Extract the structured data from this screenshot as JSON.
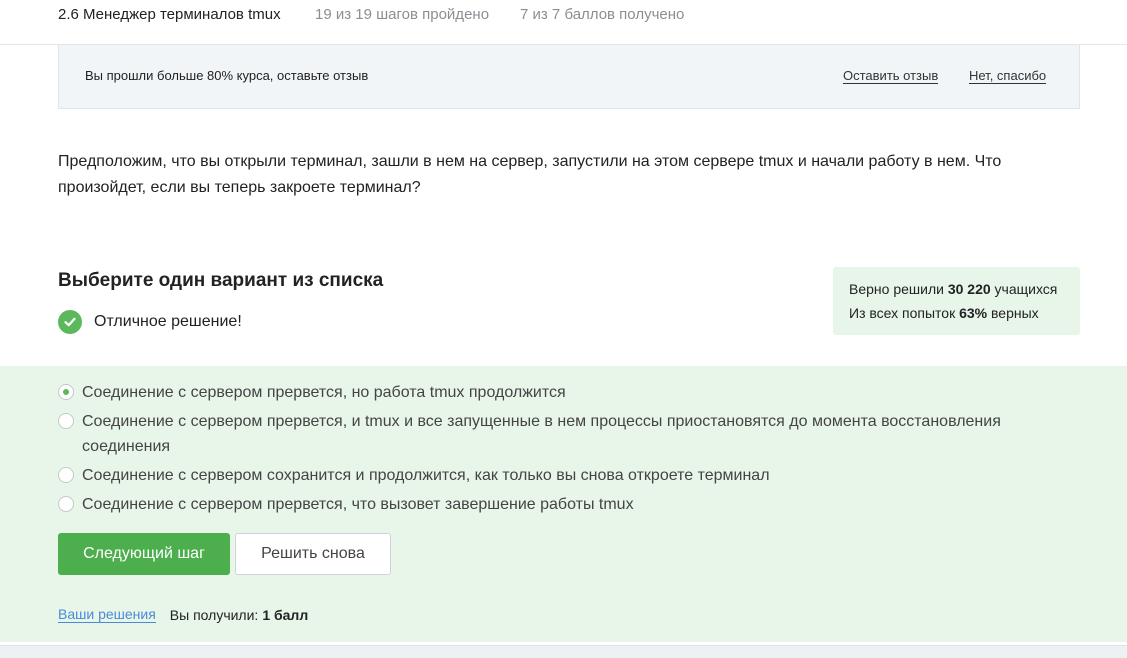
{
  "header": {
    "lesson_title": "2.6 Менеджер терминалов tmux",
    "steps_progress": "19 из 19 шагов пройдено",
    "points_progress": "7 из 7 баллов  получено"
  },
  "feedback_banner": {
    "message": "Вы прошли больше 80% курса, оставьте отзыв",
    "leave_review": "Оставить отзыв",
    "no_thanks": "Нет, спасибо"
  },
  "question": {
    "text": "Предположим, что вы открыли терминал, зашли в нем на сервер, запустили на этом сервере tmux и начали работу в нем. Что произойдет, если вы теперь закроете терминал?"
  },
  "quiz": {
    "title": "Выберите один вариант из списка",
    "result_text": "Отличное решение!",
    "stats": {
      "line1_prefix": "Верно решили",
      "line1_value": "30 220",
      "line1_suffix": "учащихся",
      "line2_prefix": "Из всех попыток",
      "line2_value": "63%",
      "line2_suffix": "верных"
    },
    "options": [
      {
        "label": "Соединение с сервером прервется, но работа tmux продолжится",
        "selected": true
      },
      {
        "label": "Соединение с сервером прервется, и tmux и все запущенные в нем процессы приостановятся до момента восстановления соединения",
        "selected": false
      },
      {
        "label": "Соединение с сервером сохранится и продолжится, как только вы снова откроете терминал",
        "selected": false
      },
      {
        "label": "Соединение с сервером прервется, что вызовет завершение работы tmux",
        "selected": false
      }
    ],
    "next_button": "Следующий шаг",
    "retry_button": "Решить снова",
    "solutions_link": "Ваши решения",
    "received_label": "Вы получили:",
    "received_value": "1 балл"
  },
  "colors": {
    "accent_green": "#4cae4c",
    "answer_bg": "#e8f6ea",
    "link_blue": "#4a8ad6"
  },
  "icons": {
    "result": "check-circle-icon"
  }
}
